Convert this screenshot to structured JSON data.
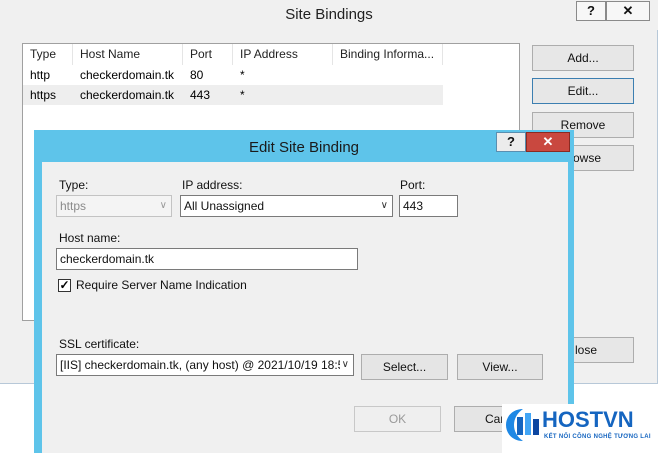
{
  "site_bindings": {
    "title": "Site Bindings",
    "help_label": "?",
    "close_label": "✕",
    "columns": [
      "Type",
      "Host Name",
      "Port",
      "IP Address",
      "Binding Informa..."
    ],
    "rows": [
      [
        "http",
        "checkerdomain.tk",
        "80",
        "*",
        ""
      ],
      [
        "https",
        "checkerdomain.tk",
        "443",
        "*",
        ""
      ]
    ],
    "buttons": {
      "add": "Add...",
      "edit": "Edit...",
      "remove": "Remove",
      "browse": "owse",
      "close": "lose"
    }
  },
  "edit_binding": {
    "title": "Edit Site Binding",
    "help_label": "?",
    "close_label": "✕",
    "type_label": "Type:",
    "type_value": "https",
    "ip_label": "IP address:",
    "ip_value": "All Unassigned",
    "port_label": "Port:",
    "port_value": "443",
    "host_label": "Host name:",
    "host_value": "checkerdomain.tk",
    "sni_checked": true,
    "sni_label": "Require Server Name Indication",
    "ssl_label": "SSL certificate:",
    "ssl_value": "[IIS] checkerdomain.tk, (any host) @ 2021/10/19 18:5",
    "select_button": "Select...",
    "view_button": "View...",
    "ok_button": "OK",
    "cancel_button": "Car"
  },
  "logo": {
    "name": "HOSTVN",
    "tagline": "KẾT NỐI CÔNG NGHỆ TƯƠNG LAI"
  }
}
